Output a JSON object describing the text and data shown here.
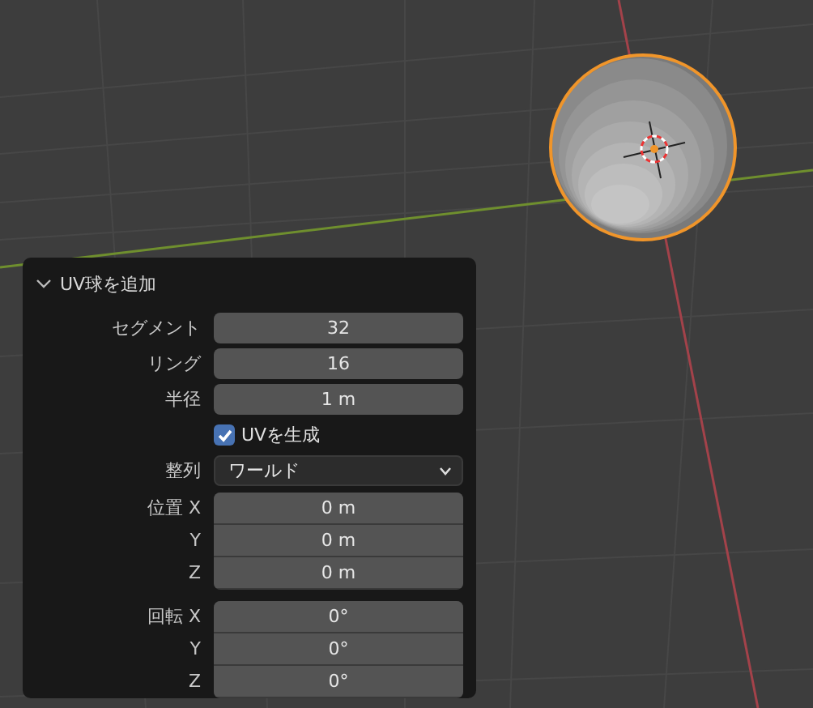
{
  "panel": {
    "title": "UV球を追加",
    "expanded": true,
    "rows": [
      {
        "kind": "number",
        "label": "セグメント",
        "value": "32"
      },
      {
        "kind": "number",
        "label": "リング",
        "value": "16"
      },
      {
        "kind": "number",
        "label": "半径",
        "value": "1 m"
      },
      {
        "kind": "checkbox",
        "label": "UVを生成",
        "checked": true
      },
      {
        "kind": "dropdown",
        "label": "整列",
        "value": "ワールド"
      }
    ],
    "groups": [
      {
        "fields": [
          {
            "label": "位置 X",
            "value": "0 m"
          },
          {
            "label": "Y",
            "value": "0 m"
          },
          {
            "label": "Z",
            "value": "0 m"
          }
        ]
      },
      {
        "fields": [
          {
            "label": "回転 X",
            "value": "0°"
          },
          {
            "label": "Y",
            "value": "0°"
          },
          {
            "label": "Z",
            "value": "0°"
          }
        ]
      }
    ]
  }
}
